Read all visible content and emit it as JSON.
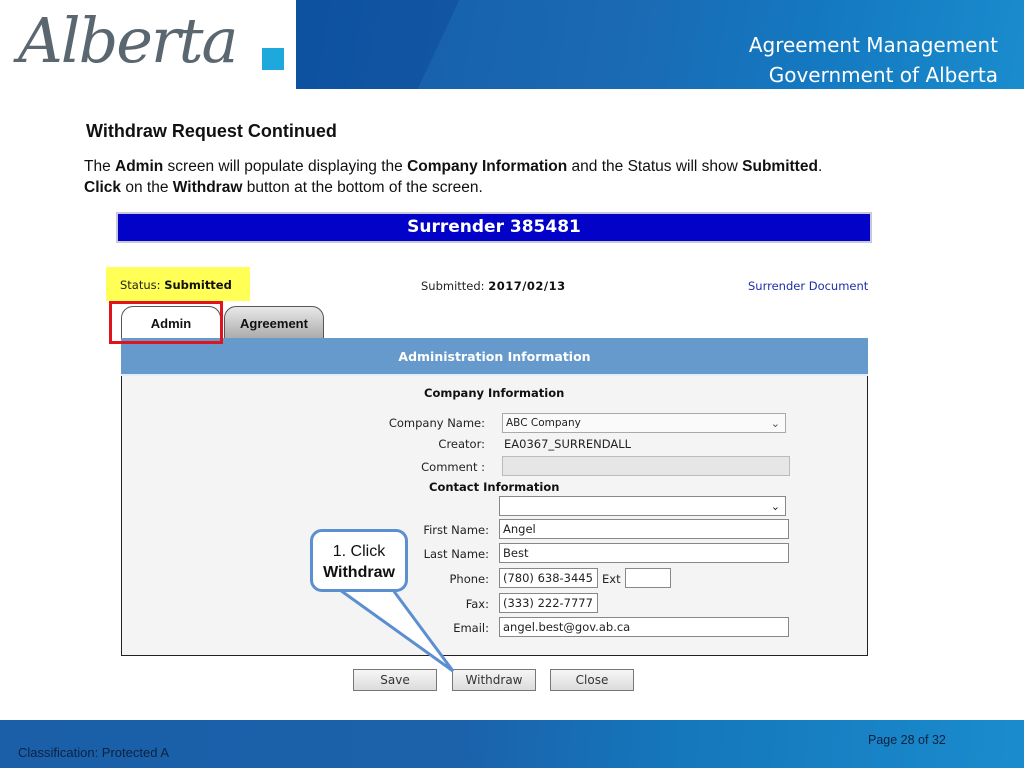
{
  "header": {
    "logo_text": "Alberta",
    "title_line1": "Agreement Management",
    "title_line2": "Government of Alberta"
  },
  "content": {
    "section_title": "Withdraw Request Continued",
    "line1": [
      {
        "text": "The ",
        "bold": false
      },
      {
        "text": "Admin",
        "bold": true
      },
      {
        "text": " screen will populate displaying the ",
        "bold": false
      },
      {
        "text": "Company Information",
        "bold": true
      },
      {
        "text": " and the Status will show ",
        "bold": false
      },
      {
        "text": "Submitted",
        "bold": true
      },
      {
        "text": ".",
        "bold": false
      }
    ],
    "line2": [
      {
        "text": "Click",
        "bold": true
      },
      {
        "text": " on the ",
        "bold": false
      },
      {
        "text": "Withdraw",
        "bold": true
      },
      {
        "text": " button at the bottom of the screen.",
        "bold": false
      }
    ]
  },
  "app": {
    "surrender_title": "Surrender 385481",
    "status_label": "Status:",
    "status_value": "Submitted",
    "submitted_label": "Submitted:",
    "submitted_date": "2017/02/13",
    "surrender_document_link": "Surrender Document",
    "tabs": [
      {
        "label": "Admin",
        "active": true
      },
      {
        "label": "Agreement",
        "active": false
      }
    ],
    "panel_title": "Administration Information",
    "company_section": "Company Information",
    "company_name_label": "Company Name:",
    "company_name_value": "ABC Company",
    "creator_label": "Creator:",
    "creator_value": "EA0367_SURRENDALL",
    "comment_label": "Comment :",
    "comment_value": "",
    "contact_section": "Contact Information",
    "contact_select_value": "",
    "first_name_label": "First Name:",
    "first_name_value": "Angel",
    "last_name_label": "Last Name:",
    "last_name_value": "Best",
    "phone_label": "Phone:",
    "phone_value": "(780) 638-3445",
    "ext_label": "Ext",
    "ext_value": "",
    "fax_label": "Fax:",
    "fax_value": "(333) 222-7777",
    "email_label": "Email:",
    "email_value": "angel.best@gov.ab.ca",
    "buttons": {
      "save": "Save",
      "withdraw": "Withdraw",
      "close": "Close"
    }
  },
  "callout": {
    "line1": "1. Click",
    "line2": "Withdraw"
  },
  "footer": {
    "classification": "Classification: Protected A",
    "page": "Page 28 of 32"
  },
  "colors": {
    "brand_blue": "#1862ad",
    "surrender_bar": "#0202c8",
    "status_highlight": "#ffff55",
    "panel_header": "#6699cc",
    "highlight_box": "#e0141e",
    "callout_border": "#5b8fd0"
  }
}
